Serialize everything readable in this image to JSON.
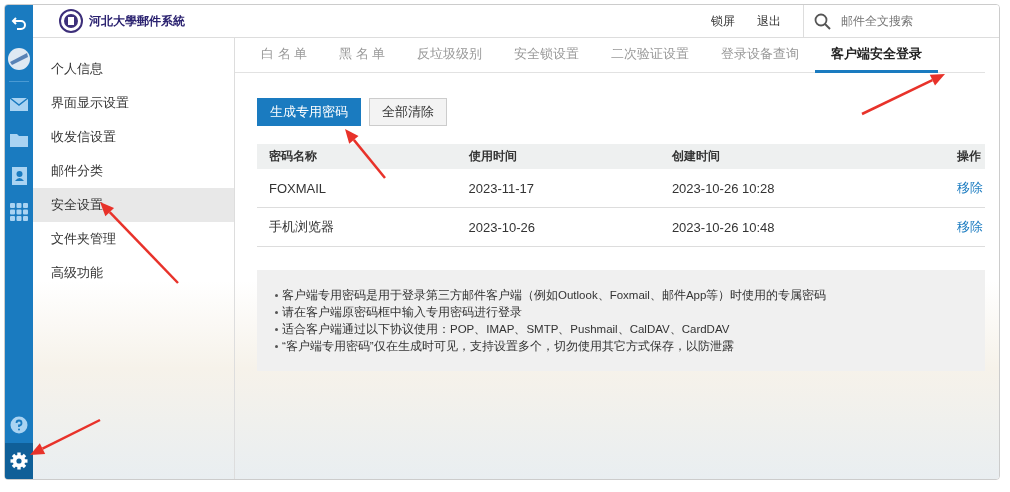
{
  "header": {
    "logo_text": "河北大學郵件系統",
    "actions": [
      "锁屏",
      "退出"
    ],
    "search": {
      "placeholder": "邮件全文搜索"
    }
  },
  "rail_items": [
    {
      "kind": "back",
      "selected": false
    },
    {
      "kind": "avatar",
      "selected": false
    },
    {
      "kind": "mail",
      "selected": false
    },
    {
      "kind": "folder",
      "selected": false
    },
    {
      "kind": "contacts",
      "selected": false
    },
    {
      "kind": "apps",
      "selected": false
    },
    {
      "kind": "help",
      "selected": false
    },
    {
      "kind": "settings",
      "selected": true
    }
  ],
  "settings_menu": [
    {
      "label": "个人信息",
      "selected": false
    },
    {
      "label": "界面显示设置",
      "selected": false
    },
    {
      "label": "收发信设置",
      "selected": false
    },
    {
      "label": "邮件分类",
      "selected": false
    },
    {
      "label": "安全设置",
      "selected": true
    },
    {
      "label": "文件夹管理",
      "selected": false
    },
    {
      "label": "高级功能",
      "selected": false
    }
  ],
  "tabs": [
    {
      "label": "白 名 单",
      "selected": false
    },
    {
      "label": "黑 名 单",
      "selected": false
    },
    {
      "label": "反垃圾级别",
      "selected": false
    },
    {
      "label": "安全锁设置",
      "selected": false
    },
    {
      "label": "二次验证设置",
      "selected": false
    },
    {
      "label": "登录设备查询",
      "selected": false
    },
    {
      "label": "客户端安全登录",
      "selected": true
    }
  ],
  "buttons": [
    {
      "label": "生成专用密码",
      "kind": "primary"
    },
    {
      "label": "全部清除",
      "kind": "secondary"
    }
  ],
  "table": {
    "columns": [
      "密码名称",
      "使用时间",
      "创建时间",
      "操作"
    ],
    "rows": [
      {
        "name": "FOXMAIL",
        "used": "2023-11-17",
        "created": "2023-10-26 10:28",
        "action": "移除"
      },
      {
        "name": "手机浏览器",
        "used": "2023-10-26",
        "created": "2023-10-26 10:48",
        "action": "移除"
      }
    ]
  },
  "notes": [
    "客户端专用密码是用于登录第三方邮件客户端（例如Outlook、Foxmail、邮件App等）时使用的专属密码",
    "请在客户端原密码框中输入专用密码进行登录",
    "适合客户端通过以下协议使用：POP、IMAP、SMTP、Pushmail、CalDAV、CardDAV",
    "“客户端专用密码”仅在生成时可见，支持设置多个，切勿使用其它方式保存，以防泄露"
  ]
}
